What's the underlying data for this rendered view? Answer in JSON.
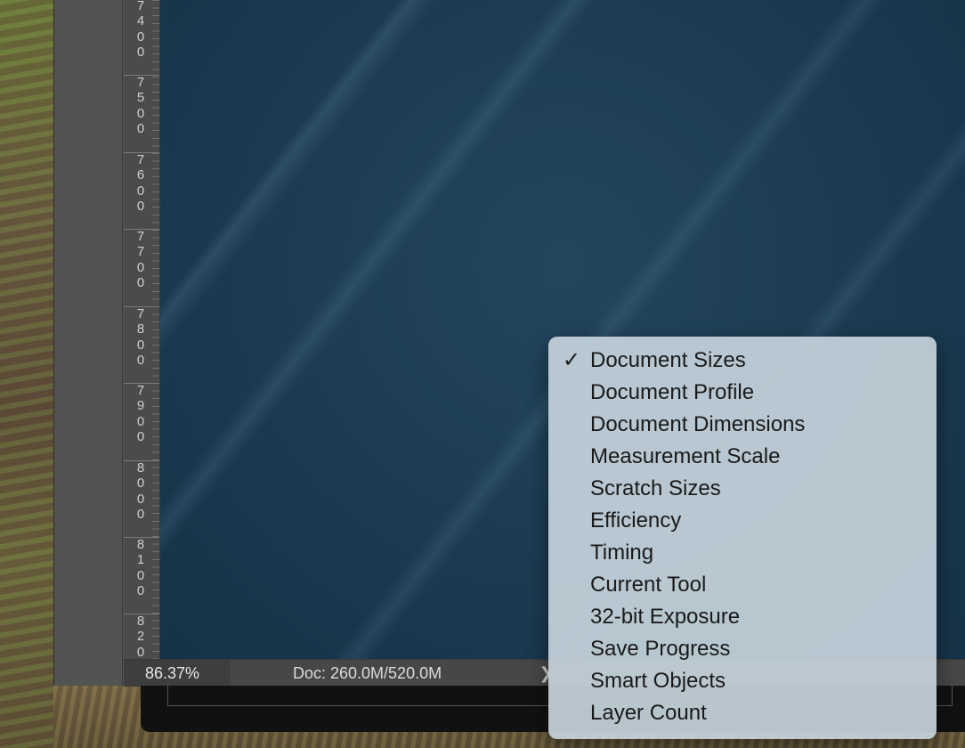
{
  "ruler": {
    "labels": [
      "7400",
      "7500",
      "7600",
      "7700",
      "7800",
      "7900",
      "8000",
      "8100",
      "820"
    ]
  },
  "status_bar": {
    "zoom": "86.37%",
    "doc_info": "Doc: 260.0M/520.0M",
    "menu_button_glyph": "❯"
  },
  "popup_menu": {
    "check_glyph": "✓",
    "selected": "Document Sizes",
    "items": [
      {
        "label": "Document Sizes",
        "checked": true
      },
      {
        "label": "Document Profile",
        "checked": false
      },
      {
        "label": "Document Dimensions",
        "checked": false
      },
      {
        "label": "Measurement Scale",
        "checked": false
      },
      {
        "label": "Scratch Sizes",
        "checked": false
      },
      {
        "label": "Efficiency",
        "checked": false
      },
      {
        "label": "Timing",
        "checked": false
      },
      {
        "label": "Current Tool",
        "checked": false
      },
      {
        "label": "32-bit Exposure",
        "checked": false
      },
      {
        "label": "Save Progress",
        "checked": false
      },
      {
        "label": "Smart Objects",
        "checked": false
      },
      {
        "label": "Layer Count",
        "checked": false
      }
    ]
  },
  "colors": {
    "canvas": "#1b3a50",
    "panel": "#535353",
    "menu_bg": "#c4d2da"
  }
}
